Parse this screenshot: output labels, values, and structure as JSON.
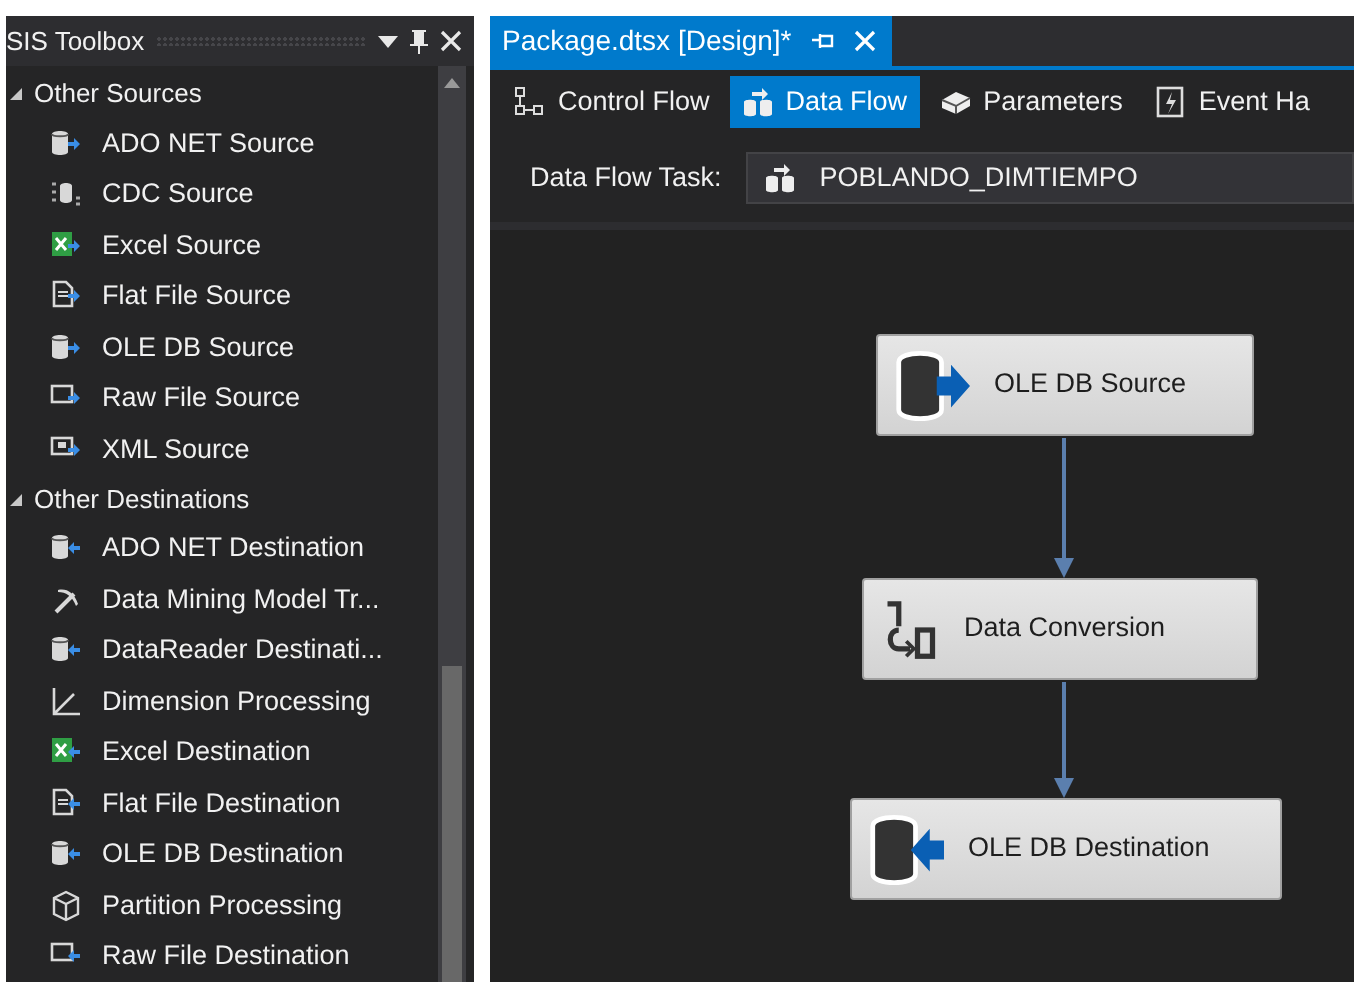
{
  "toolbox": {
    "title": "SIS Toolbox",
    "sections": [
      {
        "title": "Other Sources",
        "expanded": true,
        "items": [
          {
            "label": "ADO NET Source",
            "kind": "db-out"
          },
          {
            "label": "CDC Source",
            "kind": "cdc"
          },
          {
            "label": "Excel Source",
            "kind": "sheet-out"
          },
          {
            "label": "Flat File Source",
            "kind": "file-out"
          },
          {
            "label": "OLE DB Source",
            "kind": "db-out"
          },
          {
            "label": "Raw File Source",
            "kind": "raw-out"
          },
          {
            "label": "XML Source",
            "kind": "xml-out"
          }
        ]
      },
      {
        "title": "Other Destinations",
        "expanded": true,
        "items": [
          {
            "label": "ADO NET Destination",
            "kind": "db-in"
          },
          {
            "label": "Data Mining Model Tr...",
            "kind": "pick"
          },
          {
            "label": "DataReader Destinati...",
            "kind": "db-in"
          },
          {
            "label": "Dimension Processing",
            "kind": "axes"
          },
          {
            "label": "Excel Destination",
            "kind": "sheet-in"
          },
          {
            "label": "Flat File Destination",
            "kind": "file-in"
          },
          {
            "label": "OLE DB Destination",
            "kind": "db-in"
          },
          {
            "label": "Partition Processing",
            "kind": "cube"
          },
          {
            "label": "Raw File Destination",
            "kind": "raw-in"
          }
        ]
      }
    ]
  },
  "document_tab": {
    "title": "Package.dtsx [Design]*"
  },
  "designer_tabs": [
    {
      "label": "Control Flow",
      "kind": "flow",
      "selected": false
    },
    {
      "label": "Data Flow",
      "kind": "cylinders",
      "selected": true
    },
    {
      "label": "Parameters",
      "kind": "box",
      "selected": false
    },
    {
      "label": "Event Ha",
      "kind": "event",
      "selected": false
    }
  ],
  "data_flow_task": {
    "label": "Data Flow Task:",
    "value": "POBLANDO_DIMTIEMPO"
  },
  "canvas": {
    "nodes": [
      {
        "label": "OLE DB Source",
        "kind": "db-out"
      },
      {
        "label": "Data Conversion",
        "kind": "convert"
      },
      {
        "label": "OLE DB Destination",
        "kind": "db-in"
      }
    ]
  }
}
